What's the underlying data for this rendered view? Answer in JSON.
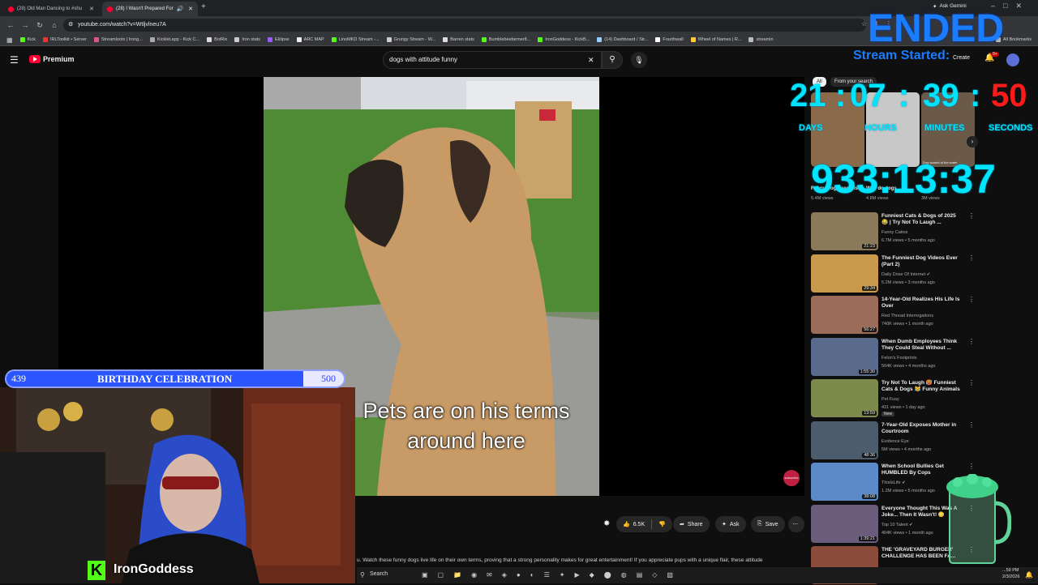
{
  "browser": {
    "tabs": [
      {
        "title": "(28) Old Man Dancing to #shu"
      },
      {
        "title": "(28) I Wasn't Prepared For"
      }
    ],
    "url": "youtube.com/watch?v=Wtljvlneu7A",
    "gemini": "Ask Gemini",
    "bookmarks": [
      "Kick",
      "IRLToolkit • Server",
      "Streamloots | Irong...",
      "Kicklet.app - Kick C...",
      "BotRix",
      "Iron stats",
      "Eklipse",
      "ARC MAP",
      "LinoMKD Stream -...",
      "Grungy Stream - W...",
      "Barren stats",
      "Bumblebeefarmer8...",
      "IronGoddess - KickB...",
      "(14) Dashboard / Str...",
      "Fourthwall",
      "Wheel of Names | R...",
      "streamin"
    ],
    "all_bookmarks": "All Bookmarks"
  },
  "youtube": {
    "logo": "Premium",
    "search_value": "dogs with attitude funny",
    "create": "Create",
    "notif_count": "9+",
    "caption_line1": "Pets are on his terms",
    "caption_line2": "around here",
    "actions": {
      "likes": "6.5K",
      "share": "Share",
      "ask": "Ask",
      "save": "Save"
    },
    "description": "u. Watch these funny dogs live life on their own terms, proving that a strong personality makes for great entertainment! If you appreciate pups with a unique flair, these attitude",
    "chips": {
      "all": "All",
      "from_channel": "From your search"
    },
    "shorts": [
      {
        "title": "Funny Dog Sees His",
        "views": "5.4M views"
      },
      {
        "title": "Why do dogs",
        "views": "4.8M views"
      },
      {
        "title": "Dog scared of the water",
        "views": "3M views"
      }
    ],
    "recommendations": [
      {
        "title": "Funniest Cats & Dogs of 2025 😂 | Try Not To Laugh ...",
        "channel": "Funny Catios",
        "meta": "6.7M views • 5 months ago",
        "duration": "21:23",
        "color": "#8a7a5a"
      },
      {
        "title": "The Funniest Dog Videos Ever (Part 2)",
        "channel": "Daily Dose Of Internet ✔",
        "meta": "5.2M views • 3 months ago",
        "duration": "29:34",
        "color": "#c99a4c"
      },
      {
        "title": "14-Year-Old Realizes His Life Is Over",
        "channel": "Red Thread Interrogations",
        "meta": "740K views • 1 month ago",
        "duration": "56:27",
        "color": "#9c6c5a"
      },
      {
        "title": "When Dumb Employees Think They Could Steal Without ...",
        "channel": "Felon's Footprints",
        "meta": "564K views • 4 months ago",
        "duration": "1:55:30",
        "color": "#5a6a8c"
      },
      {
        "title": "Try Not To Laugh 🥵 Funniest Cats & Dogs 😹 Funny Animals",
        "channel": "Pet Fusy",
        "meta": "431 views • 1 day ago",
        "duration": "13:59",
        "color": "#7c8a4c",
        "badge": "New"
      },
      {
        "title": "7-Year-Old Exposes Mother in Courtroom",
        "channel": "Evidence Eye",
        "meta": "5M views • 4 months ago",
        "duration": "48:36",
        "color": "#4c5c6c"
      },
      {
        "title": "When School Bullies Get HUMBLED By Cops",
        "channel": "ThisIsLife ✔",
        "meta": "1.2M views • 5 months ago",
        "duration": "38:08",
        "color": "#5c8ac8"
      },
      {
        "title": "Everyone Thought This Was A Joke... Then It Wasn't! 😳",
        "channel": "Top 10 Talent ✔",
        "meta": "404K views • 1 month ago",
        "duration": "1:39:21",
        "color": "#6c5c7c"
      },
      {
        "title": "THE 'GRAVEYARD BURGER' CHALLENGE HAS BEEN FA...",
        "channel": "",
        "meta": "",
        "duration": "",
        "color": "#8c4c3c"
      }
    ]
  },
  "overlay": {
    "ended": "ENDED",
    "stream_started": "Stream Started:",
    "days": "21",
    "hours": "07",
    "minutes": "39",
    "seconds": "50",
    "label_days": "DAYS",
    "label_hours": "HOURS",
    "label_minutes": "MINUTES",
    "label_seconds": "SECONDS",
    "timer": "933:13:37",
    "goal_current": "439",
    "goal_title": "BIRTHDAY CELEBRATION",
    "goal_target": "500",
    "goal_progress": 0.878,
    "streamer_name": "IronGoddess",
    "subscribe": "subscribe"
  },
  "taskbar": {
    "search": "Search",
    "time": "...59 PM",
    "date": "2/3/2026"
  },
  "colors": {
    "accent_red": "#ff0033",
    "neon": "#00e5ff",
    "goal_blue": "#2a55ff",
    "kick_green": "#53fc18"
  }
}
